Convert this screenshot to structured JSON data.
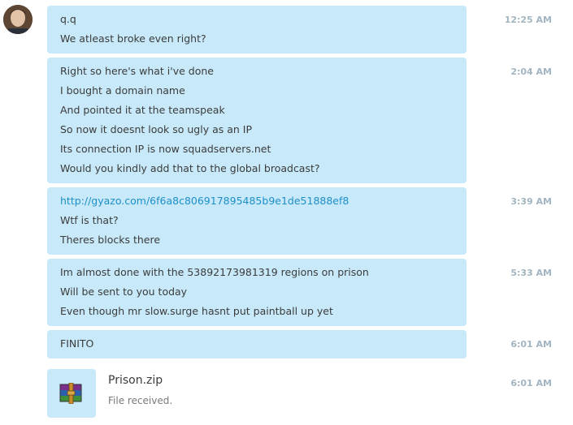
{
  "messages": [
    {
      "lines": [
        "q.q",
        "We atleast broke even right?"
      ],
      "time": "12:25 AM"
    },
    {
      "lines": [
        "Right so here's what i've done",
        "I bought a domain name",
        "And pointed it at the teamspeak",
        "So now it doesnt look so ugly as an IP",
        "Its connection IP is now squadservers.net",
        "Would you kindly add that to the global broadcast?"
      ],
      "time": "2:04 AM"
    },
    {
      "link": "http://gyazo.com/6f6a8c806917895485b9e1de51888ef8",
      "lines": [
        "Wtf is that?",
        "Theres blocks there"
      ],
      "time": "3:39 AM"
    },
    {
      "lines": [
        "Im almost done with the 53892173981319 regions on prison",
        "Will be sent to you today",
        "Even though mr slow.surge hasnt put paintball up yet"
      ],
      "time": "5:33 AM"
    },
    {
      "lines": [
        "FINITO"
      ],
      "time": "6:01 AM"
    }
  ],
  "file": {
    "name": "Prison.zip",
    "status": "File received.",
    "time": "6:01 AM",
    "icon": "winrar-archive-icon"
  },
  "colors": {
    "bubble": "#c7e9f9",
    "link": "#1e8fc9",
    "timestamp": "#a2b5c1"
  }
}
